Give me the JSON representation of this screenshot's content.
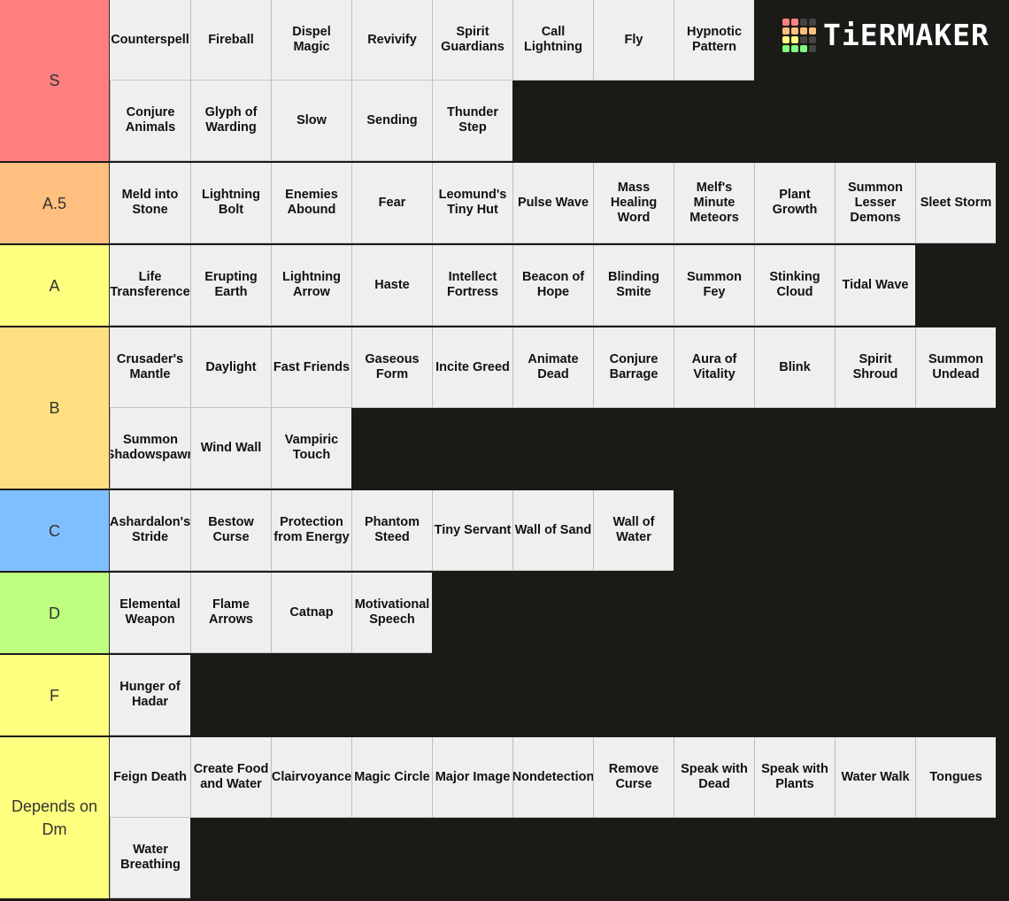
{
  "brand": {
    "logo_text": "TiERMAKER",
    "logo_grid_colors": [
      "#ff7f7f",
      "#ff7f7f",
      "#444444",
      "#444444",
      "#ffbf7f",
      "#ffbf7f",
      "#ffbf7f",
      "#ffbf7f",
      "#ffff7f",
      "#ffff7f",
      "#444444",
      "#444444",
      "#7fff7f",
      "#7fff7f",
      "#7fff7f",
      "#444444"
    ]
  },
  "tiers": [
    {
      "label": "S",
      "color": "#ff7f7f",
      "items": [
        "Counterspell",
        "Fireball",
        "Dispel Magic",
        "Revivify",
        "Spirit Guardians",
        "Call Lightning",
        "Fly",
        "Hypnotic Pattern",
        "Conjure Animals",
        "Glyph of Warding",
        "Slow",
        "Sending",
        "Thunder Step"
      ]
    },
    {
      "label": "A.5",
      "color": "#ffbf7f",
      "items": [
        "Meld into Stone",
        "Lightning Bolt",
        "Enemies Abound",
        "Fear",
        "Leomund's Tiny Hut",
        "Pulse Wave",
        "Mass Healing Word",
        "Melf's Minute Meteors",
        "Plant Growth",
        "Summon Lesser Demons",
        "Sleet Storm"
      ]
    },
    {
      "label": "A",
      "color": "#ffff7f",
      "items": [
        "Life Transference",
        "Erupting Earth",
        "Lightning Arrow",
        "Haste",
        "Intellect Fortress",
        "Beacon of Hope",
        "Blinding Smite",
        "Summon Fey",
        "Stinking Cloud",
        "Tidal Wave"
      ]
    },
    {
      "label": "B",
      "color": "#ffdf80",
      "items": [
        "Crusader's Mantle",
        "Daylight",
        "Fast Friends",
        "Gaseous Form",
        "Incite Greed",
        "Animate Dead",
        "Conjure Barrage",
        "Aura of Vitality",
        "Blink",
        "Spirit Shroud",
        "Summon Undead",
        "Summon Shadowspawn",
        "Wind Wall",
        "Vampiric Touch"
      ]
    },
    {
      "label": "C",
      "color": "#7fbfff",
      "items": [
        "Ashardalon's Stride",
        "Bestow Curse",
        "Protection from Energy",
        "Phantom Steed",
        "Tiny Servant",
        "Wall of Sand",
        "Wall of Water"
      ]
    },
    {
      "label": "D",
      "color": "#bfff7f",
      "items": [
        "Elemental Weapon",
        "Flame Arrows",
        "Catnap",
        "Motivational Speech"
      ]
    },
    {
      "label": "F",
      "color": "#ffff7f",
      "items": [
        "Hunger of Hadar"
      ]
    },
    {
      "label": "Depends on Dm",
      "color": "#ffff7f",
      "items": [
        "Feign Death",
        "Create Food and Water",
        "Clairvoyance",
        "Magic Circle",
        "Major Image",
        "Nondetection",
        "Remove Curse",
        "Speak with Dead",
        "Speak with Plants",
        "Water Walk",
        "Tongues",
        "Water Breathing"
      ]
    }
  ]
}
